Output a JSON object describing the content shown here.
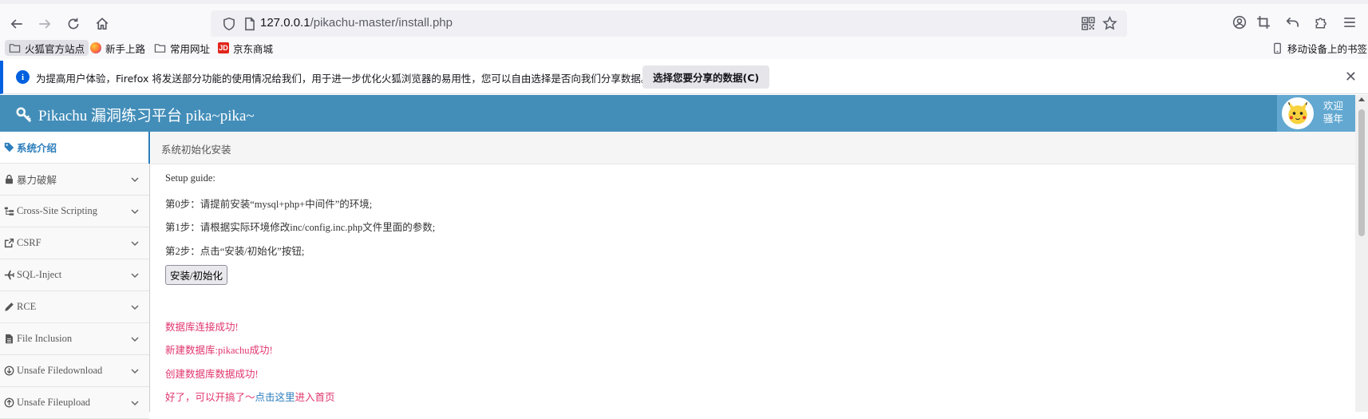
{
  "browser": {
    "url_host": "127.0.0.1",
    "url_path": "/pikachu-master/install.php",
    "bookmarks": [
      {
        "label": "火狐官方站点",
        "icon": "folder-icon"
      },
      {
        "label": "新手上路",
        "icon": "firefox-icon"
      },
      {
        "label": "常用网址",
        "icon": "folder-icon"
      },
      {
        "label": "京东商城",
        "icon": "jd-icon"
      }
    ],
    "mobile_bookmarks": "移动设备上的书签",
    "jd_logo": "JD",
    "notification": {
      "message": "为提高用户体验，Firefox 将发送部分功能的使用情况给我们，用于进一步优化火狐浏览器的易用性，您可以自由选择是否向我们分享数据。",
      "button": "选择您要分享的数据(C)",
      "close": "✕",
      "info_glyph": "i"
    }
  },
  "header": {
    "brand": "Pikachu 漏洞练习平台 pika~pika~",
    "welcome_line1": "欢迎",
    "welcome_line2": "骚年"
  },
  "sidebar": {
    "items": [
      {
        "label": "系统介绍",
        "icon": "tag-icon",
        "active": true
      },
      {
        "label": "暴力破解",
        "icon": "lock-icon"
      },
      {
        "label": "Cross-Site Scripting",
        "icon": "tree-icon"
      },
      {
        "label": "CSRF",
        "icon": "share-icon"
      },
      {
        "label": "SQL-Inject",
        "icon": "plane-icon"
      },
      {
        "label": "RCE",
        "icon": "pencil-icon"
      },
      {
        "label": "File Inclusion",
        "icon": "file-icon"
      },
      {
        "label": "Unsafe Filedownload",
        "icon": "download-icon"
      },
      {
        "label": "Unsafe Fileupload",
        "icon": "upload-icon"
      }
    ]
  },
  "breadcrumb": "系统初始化安装",
  "main": {
    "guide_title": "Setup guide:",
    "step0": "第0步：请提前安装“mysql+php+中间件”的环境;",
    "step1": "第1步：请根据实际环境修改inc/config.inc.php文件里面的参数;",
    "step2": "第2步：点击“安装/初始化”按钮;",
    "install_button": "安装/初始化",
    "result1": "数据库连接成功!",
    "result2": "新建数据库:pikachu成功!",
    "result3": "创建数据库数据成功!",
    "result4_prefix": "好了，可以开搞了～",
    "result4_link": "点击这里",
    "result4_suffix": "进入首页"
  },
  "colors": {
    "header": "#438eb9",
    "success": "#e0356d",
    "link": "#2b7dbc"
  }
}
